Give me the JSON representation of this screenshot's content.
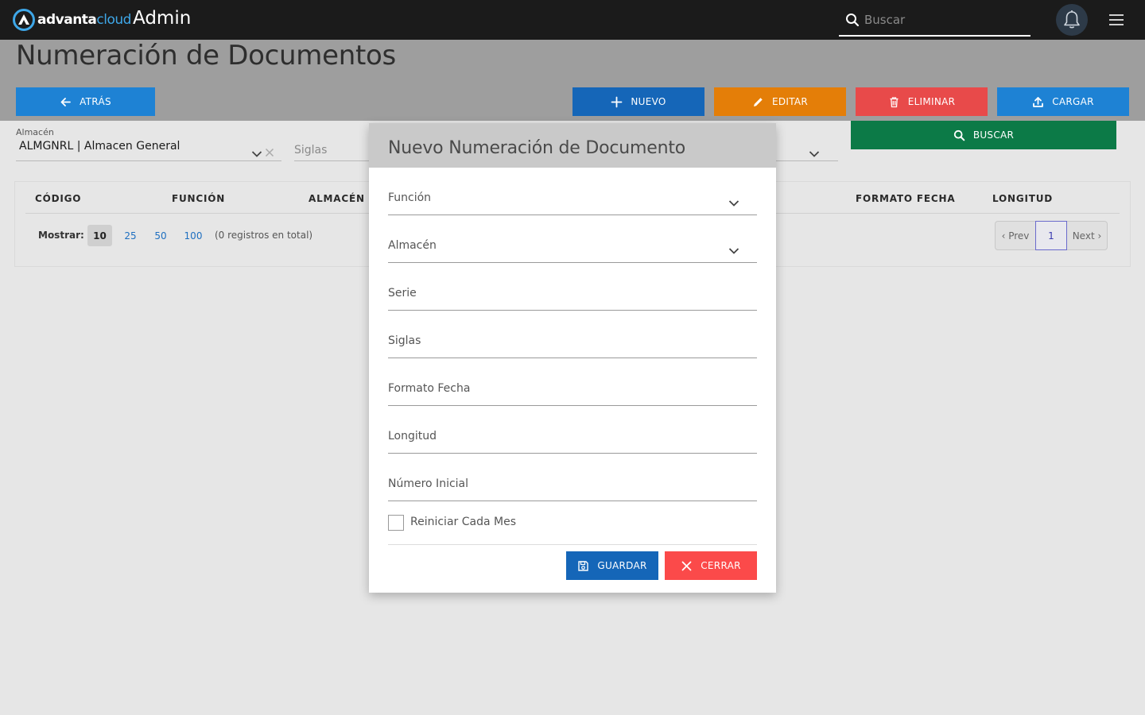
{
  "header": {
    "logo_bold": "advanta",
    "logo_light": "cloud",
    "app_title": "Admin",
    "search_placeholder": "Buscar",
    "accent_color": "#3ea7e8"
  },
  "page": {
    "title": "Numeración de Documentos"
  },
  "toolbar": {
    "back_label": "ATRÁS",
    "new_label": "NUEVO",
    "edit_label": "EDITAR",
    "delete_label": "ELIMINAR",
    "upload_label": "CARGAR",
    "search_label": "BUSCAR"
  },
  "filters": {
    "warehouse_label": "Almacén",
    "warehouse_value": "ALMGNRL | Almacen General",
    "siglas_placeholder": "Siglas"
  },
  "table": {
    "columns": [
      "CÓDIGO",
      "FUNCIÓN",
      "ALMACÉN",
      "FORMATO FECHA",
      "LONGITUD"
    ],
    "show_label": "Mostrar:",
    "page_sizes": [
      "10",
      "25",
      "50",
      "100"
    ],
    "selected_page_size": "10",
    "total_text": "(0 registros en total)",
    "prev_label": "‹ Prev",
    "current_page": "1",
    "next_label": "Next ›"
  },
  "modal": {
    "title": "Nuevo Numeración de Documento",
    "fields": {
      "funcion": "Función",
      "almacen": "Almacén",
      "serie": "Serie",
      "siglas": "Siglas",
      "formato_fecha": "Formato Fecha",
      "longitud": "Longitud",
      "numero_inicial": "Número Inicial"
    },
    "checkbox_label": "Reiniciar Cada Mes",
    "save_label": "GUARDAR",
    "close_label": "CERRAR"
  }
}
